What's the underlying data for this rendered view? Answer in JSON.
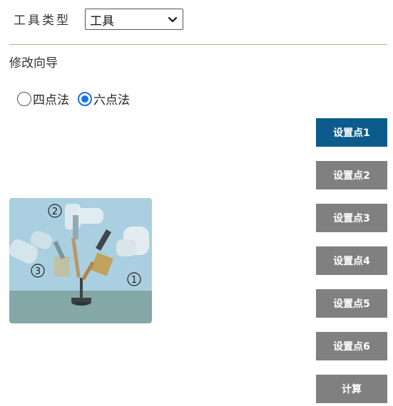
{
  "tool_type": {
    "label": "工具类型",
    "selected": "工具"
  },
  "wizard": {
    "title": "修改向导"
  },
  "method": {
    "options": [
      {
        "label": "四点法",
        "checked": false
      },
      {
        "label": "六点法",
        "checked": true
      }
    ]
  },
  "illustration": {
    "markers": [
      "②",
      "③",
      "①"
    ]
  },
  "buttons": {
    "point1": "设置点1",
    "point2": "设置点2",
    "point3": "设置点3",
    "point4": "设置点4",
    "point5": "设置点5",
    "point6": "设置点6",
    "calculate": "计算"
  },
  "colors": {
    "active_button": "#0b5c8c",
    "button": "#808080",
    "divider": "#9bbf6a",
    "radio_accent": "#1a73e8"
  }
}
